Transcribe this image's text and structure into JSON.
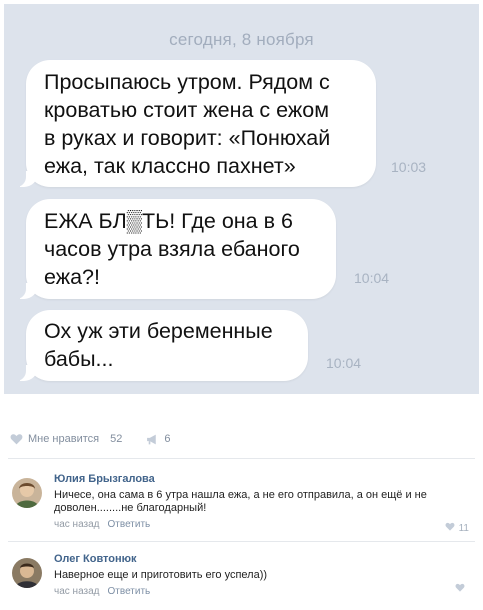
{
  "chat": {
    "date_label": "сегодня, 8 ноября",
    "messages": [
      {
        "text": "Просыпаюсь утром. Рядом с\nкроватью стоит жена с ежом\nв руках и говорит: «Понюхай\nежа, так классно пахнет»",
        "time": "10:03"
      },
      {
        "text": "ЕЖА БЛ▒ТЬ! Где она в 6\nчасов утра взяла ебаного\nежа?!",
        "time": "10:04"
      },
      {
        "text": "Ох уж эти беременные\nбабы...",
        "time": "10:04"
      }
    ]
  },
  "post_actions": {
    "likes_label": "Мне нравится",
    "likes_count": "52",
    "shares_count": "6"
  },
  "comments": [
    {
      "author": "Юлия Брызгалова",
      "text": "Ничесе, она сама в 6 утра нашла ежа, а не его отправила, а он ещё и не доволен........не благодарный!",
      "time": "час назад",
      "reply_label": "Ответить",
      "likes": "11"
    },
    {
      "author": "Олег Ковтонюк",
      "text": "Наверное еще и приготовить его успела))",
      "time": "час назад",
      "reply_label": "Ответить",
      "likes": ""
    }
  ],
  "colors": {
    "chat_background": "#dde3ec",
    "bubble": "#ffffff",
    "link": "#42648b",
    "meta": "#939ba5"
  },
  "icons": [
    "heart-icon",
    "megaphone-icon",
    "avatar-photo"
  ]
}
